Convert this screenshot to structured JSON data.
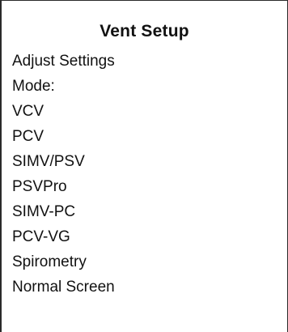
{
  "screen": {
    "title": "Vent Setup"
  },
  "menu": {
    "items": [
      {
        "label": "Adjust Settings"
      },
      {
        "label": "Mode:"
      },
      {
        "label": "VCV"
      },
      {
        "label": "PCV"
      },
      {
        "label": "SIMV/PSV"
      },
      {
        "label": "PSVPro"
      },
      {
        "label": "SIMV-PC"
      },
      {
        "label": "PCV-VG"
      },
      {
        "label": "Spirometry"
      },
      {
        "label": "Normal Screen"
      }
    ]
  }
}
